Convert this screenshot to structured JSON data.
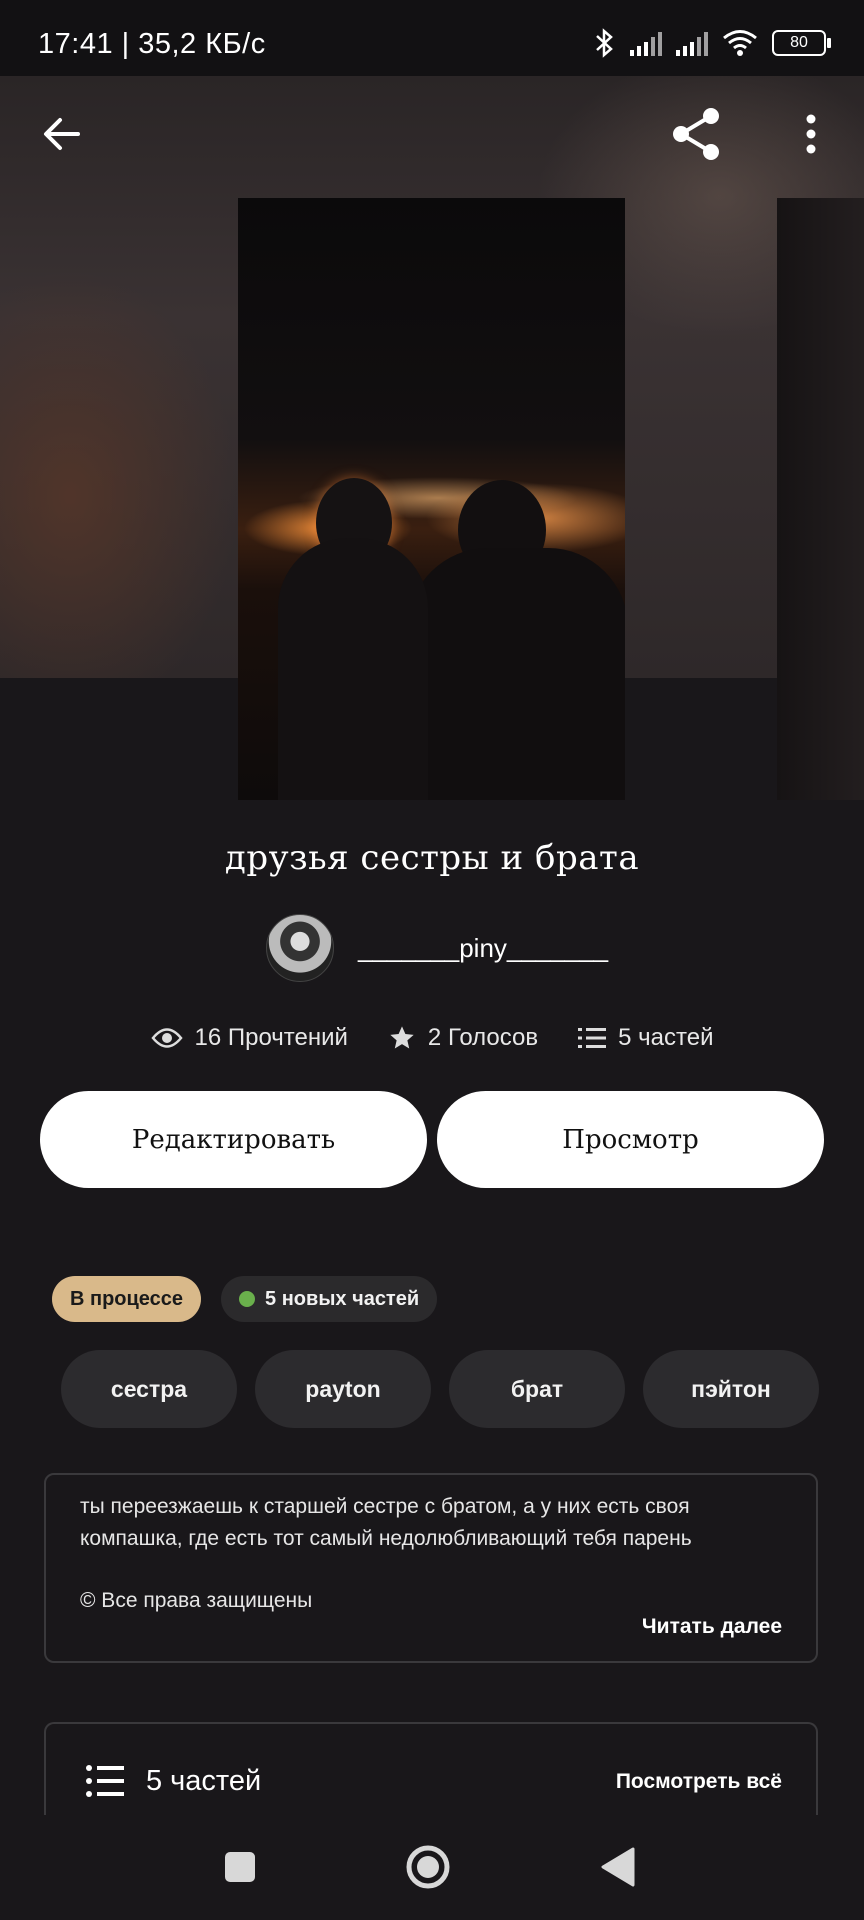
{
  "status_bar": {
    "time": "17:41 | 35,2 КБ/с",
    "battery": "80",
    "icons": [
      "bluetooth-icon",
      "signal-icon",
      "signal-icon",
      "wifi-icon",
      "battery-icon"
    ]
  },
  "toolbar": {
    "icons": [
      "back-arrow-icon",
      "share-icon",
      "more-vert-icon"
    ]
  },
  "story": {
    "title": "друзья сестры и брата",
    "author": "_______piny_______",
    "stats": {
      "reads": "16 Прочтений",
      "votes": "2 Голосов",
      "parts": "5 частей"
    }
  },
  "actions": {
    "edit": "Редактировать",
    "preview": "Просмотр"
  },
  "badges": {
    "status": "В процессе",
    "new_parts": "5 новых частей"
  },
  "tags": [
    "сестра",
    "payton",
    "брат",
    "пэйтон"
  ],
  "description": {
    "text": "ты переезжаешь к старшей сестре с братом, а у них есть своя компашка, где есть тот самый недолюбливающий тебя парень",
    "rights": "© Все права защищены",
    "read_more": "Читать далее"
  },
  "parts_section": {
    "title": "5 частей",
    "see_all": "Посмотреть всё"
  },
  "colors": {
    "background": "#19171a",
    "status_badge": "#d9b98a",
    "new_dot": "#6ab04c",
    "button": "#ffffff"
  }
}
